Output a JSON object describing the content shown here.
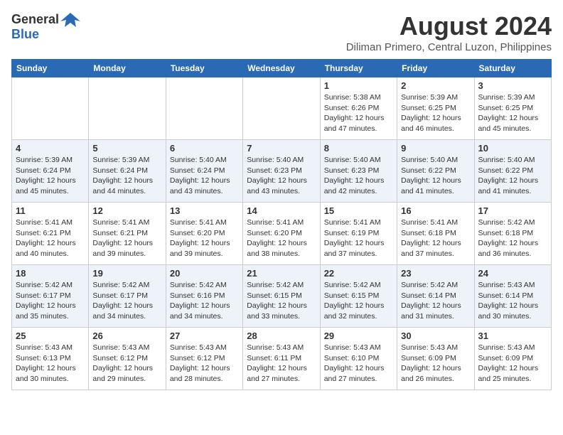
{
  "header": {
    "logo_general": "General",
    "logo_blue": "Blue",
    "month_title": "August 2024",
    "location": "Diliman Primero, Central Luzon, Philippines"
  },
  "weekdays": [
    "Sunday",
    "Monday",
    "Tuesday",
    "Wednesday",
    "Thursday",
    "Friday",
    "Saturday"
  ],
  "weeks": [
    [
      {
        "day": "",
        "info": ""
      },
      {
        "day": "",
        "info": ""
      },
      {
        "day": "",
        "info": ""
      },
      {
        "day": "",
        "info": ""
      },
      {
        "day": "1",
        "info": "Sunrise: 5:38 AM\nSunset: 6:26 PM\nDaylight: 12 hours\nand 47 minutes."
      },
      {
        "day": "2",
        "info": "Sunrise: 5:39 AM\nSunset: 6:25 PM\nDaylight: 12 hours\nand 46 minutes."
      },
      {
        "day": "3",
        "info": "Sunrise: 5:39 AM\nSunset: 6:25 PM\nDaylight: 12 hours\nand 45 minutes."
      }
    ],
    [
      {
        "day": "4",
        "info": "Sunrise: 5:39 AM\nSunset: 6:24 PM\nDaylight: 12 hours\nand 45 minutes."
      },
      {
        "day": "5",
        "info": "Sunrise: 5:39 AM\nSunset: 6:24 PM\nDaylight: 12 hours\nand 44 minutes."
      },
      {
        "day": "6",
        "info": "Sunrise: 5:40 AM\nSunset: 6:24 PM\nDaylight: 12 hours\nand 43 minutes."
      },
      {
        "day": "7",
        "info": "Sunrise: 5:40 AM\nSunset: 6:23 PM\nDaylight: 12 hours\nand 43 minutes."
      },
      {
        "day": "8",
        "info": "Sunrise: 5:40 AM\nSunset: 6:23 PM\nDaylight: 12 hours\nand 42 minutes."
      },
      {
        "day": "9",
        "info": "Sunrise: 5:40 AM\nSunset: 6:22 PM\nDaylight: 12 hours\nand 41 minutes."
      },
      {
        "day": "10",
        "info": "Sunrise: 5:40 AM\nSunset: 6:22 PM\nDaylight: 12 hours\nand 41 minutes."
      }
    ],
    [
      {
        "day": "11",
        "info": "Sunrise: 5:41 AM\nSunset: 6:21 PM\nDaylight: 12 hours\nand 40 minutes."
      },
      {
        "day": "12",
        "info": "Sunrise: 5:41 AM\nSunset: 6:21 PM\nDaylight: 12 hours\nand 39 minutes."
      },
      {
        "day": "13",
        "info": "Sunrise: 5:41 AM\nSunset: 6:20 PM\nDaylight: 12 hours\nand 39 minutes."
      },
      {
        "day": "14",
        "info": "Sunrise: 5:41 AM\nSunset: 6:20 PM\nDaylight: 12 hours\nand 38 minutes."
      },
      {
        "day": "15",
        "info": "Sunrise: 5:41 AM\nSunset: 6:19 PM\nDaylight: 12 hours\nand 37 minutes."
      },
      {
        "day": "16",
        "info": "Sunrise: 5:41 AM\nSunset: 6:18 PM\nDaylight: 12 hours\nand 37 minutes."
      },
      {
        "day": "17",
        "info": "Sunrise: 5:42 AM\nSunset: 6:18 PM\nDaylight: 12 hours\nand 36 minutes."
      }
    ],
    [
      {
        "day": "18",
        "info": "Sunrise: 5:42 AM\nSunset: 6:17 PM\nDaylight: 12 hours\nand 35 minutes."
      },
      {
        "day": "19",
        "info": "Sunrise: 5:42 AM\nSunset: 6:17 PM\nDaylight: 12 hours\nand 34 minutes."
      },
      {
        "day": "20",
        "info": "Sunrise: 5:42 AM\nSunset: 6:16 PM\nDaylight: 12 hours\nand 34 minutes."
      },
      {
        "day": "21",
        "info": "Sunrise: 5:42 AM\nSunset: 6:15 PM\nDaylight: 12 hours\nand 33 minutes."
      },
      {
        "day": "22",
        "info": "Sunrise: 5:42 AM\nSunset: 6:15 PM\nDaylight: 12 hours\nand 32 minutes."
      },
      {
        "day": "23",
        "info": "Sunrise: 5:42 AM\nSunset: 6:14 PM\nDaylight: 12 hours\nand 31 minutes."
      },
      {
        "day": "24",
        "info": "Sunrise: 5:43 AM\nSunset: 6:14 PM\nDaylight: 12 hours\nand 30 minutes."
      }
    ],
    [
      {
        "day": "25",
        "info": "Sunrise: 5:43 AM\nSunset: 6:13 PM\nDaylight: 12 hours\nand 30 minutes."
      },
      {
        "day": "26",
        "info": "Sunrise: 5:43 AM\nSunset: 6:12 PM\nDaylight: 12 hours\nand 29 minutes."
      },
      {
        "day": "27",
        "info": "Sunrise: 5:43 AM\nSunset: 6:12 PM\nDaylight: 12 hours\nand 28 minutes."
      },
      {
        "day": "28",
        "info": "Sunrise: 5:43 AM\nSunset: 6:11 PM\nDaylight: 12 hours\nand 27 minutes."
      },
      {
        "day": "29",
        "info": "Sunrise: 5:43 AM\nSunset: 6:10 PM\nDaylight: 12 hours\nand 27 minutes."
      },
      {
        "day": "30",
        "info": "Sunrise: 5:43 AM\nSunset: 6:09 PM\nDaylight: 12 hours\nand 26 minutes."
      },
      {
        "day": "31",
        "info": "Sunrise: 5:43 AM\nSunset: 6:09 PM\nDaylight: 12 hours\nand 25 minutes."
      }
    ]
  ]
}
